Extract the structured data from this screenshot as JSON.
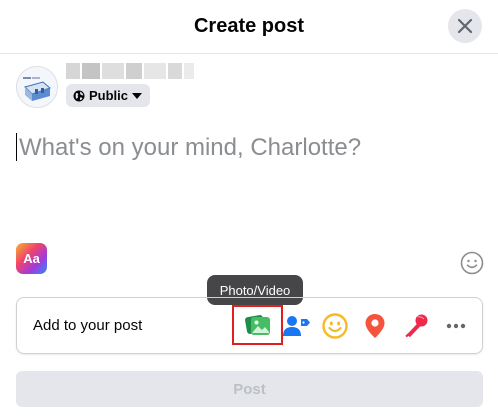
{
  "header": {
    "title": "Create post"
  },
  "user": {
    "privacy_label": "Public"
  },
  "composer": {
    "placeholder": "What's on your mind, Charlotte?"
  },
  "format_button": {
    "label": "Aa"
  },
  "tooltip": {
    "text": "Photo/Video"
  },
  "add_to_post": {
    "label": "Add to your post",
    "options": [
      {
        "icon": "photo-video-icon",
        "color": "#45bd62"
      },
      {
        "icon": "tag-people-icon",
        "color": "#1877f2"
      },
      {
        "icon": "feeling-activity-icon",
        "color": "#f7b928"
      },
      {
        "icon": "check-in-icon",
        "color": "#f5533d"
      },
      {
        "icon": "live-video-icon",
        "color": "#f02849"
      },
      {
        "icon": "more-icon",
        "color": "#65676b"
      }
    ]
  },
  "footer": {
    "post_label": "Post"
  },
  "colors": {
    "highlight_border": "#e0201d",
    "disabled_bg": "#e4e6eb",
    "disabled_text": "#bcc0c4"
  }
}
